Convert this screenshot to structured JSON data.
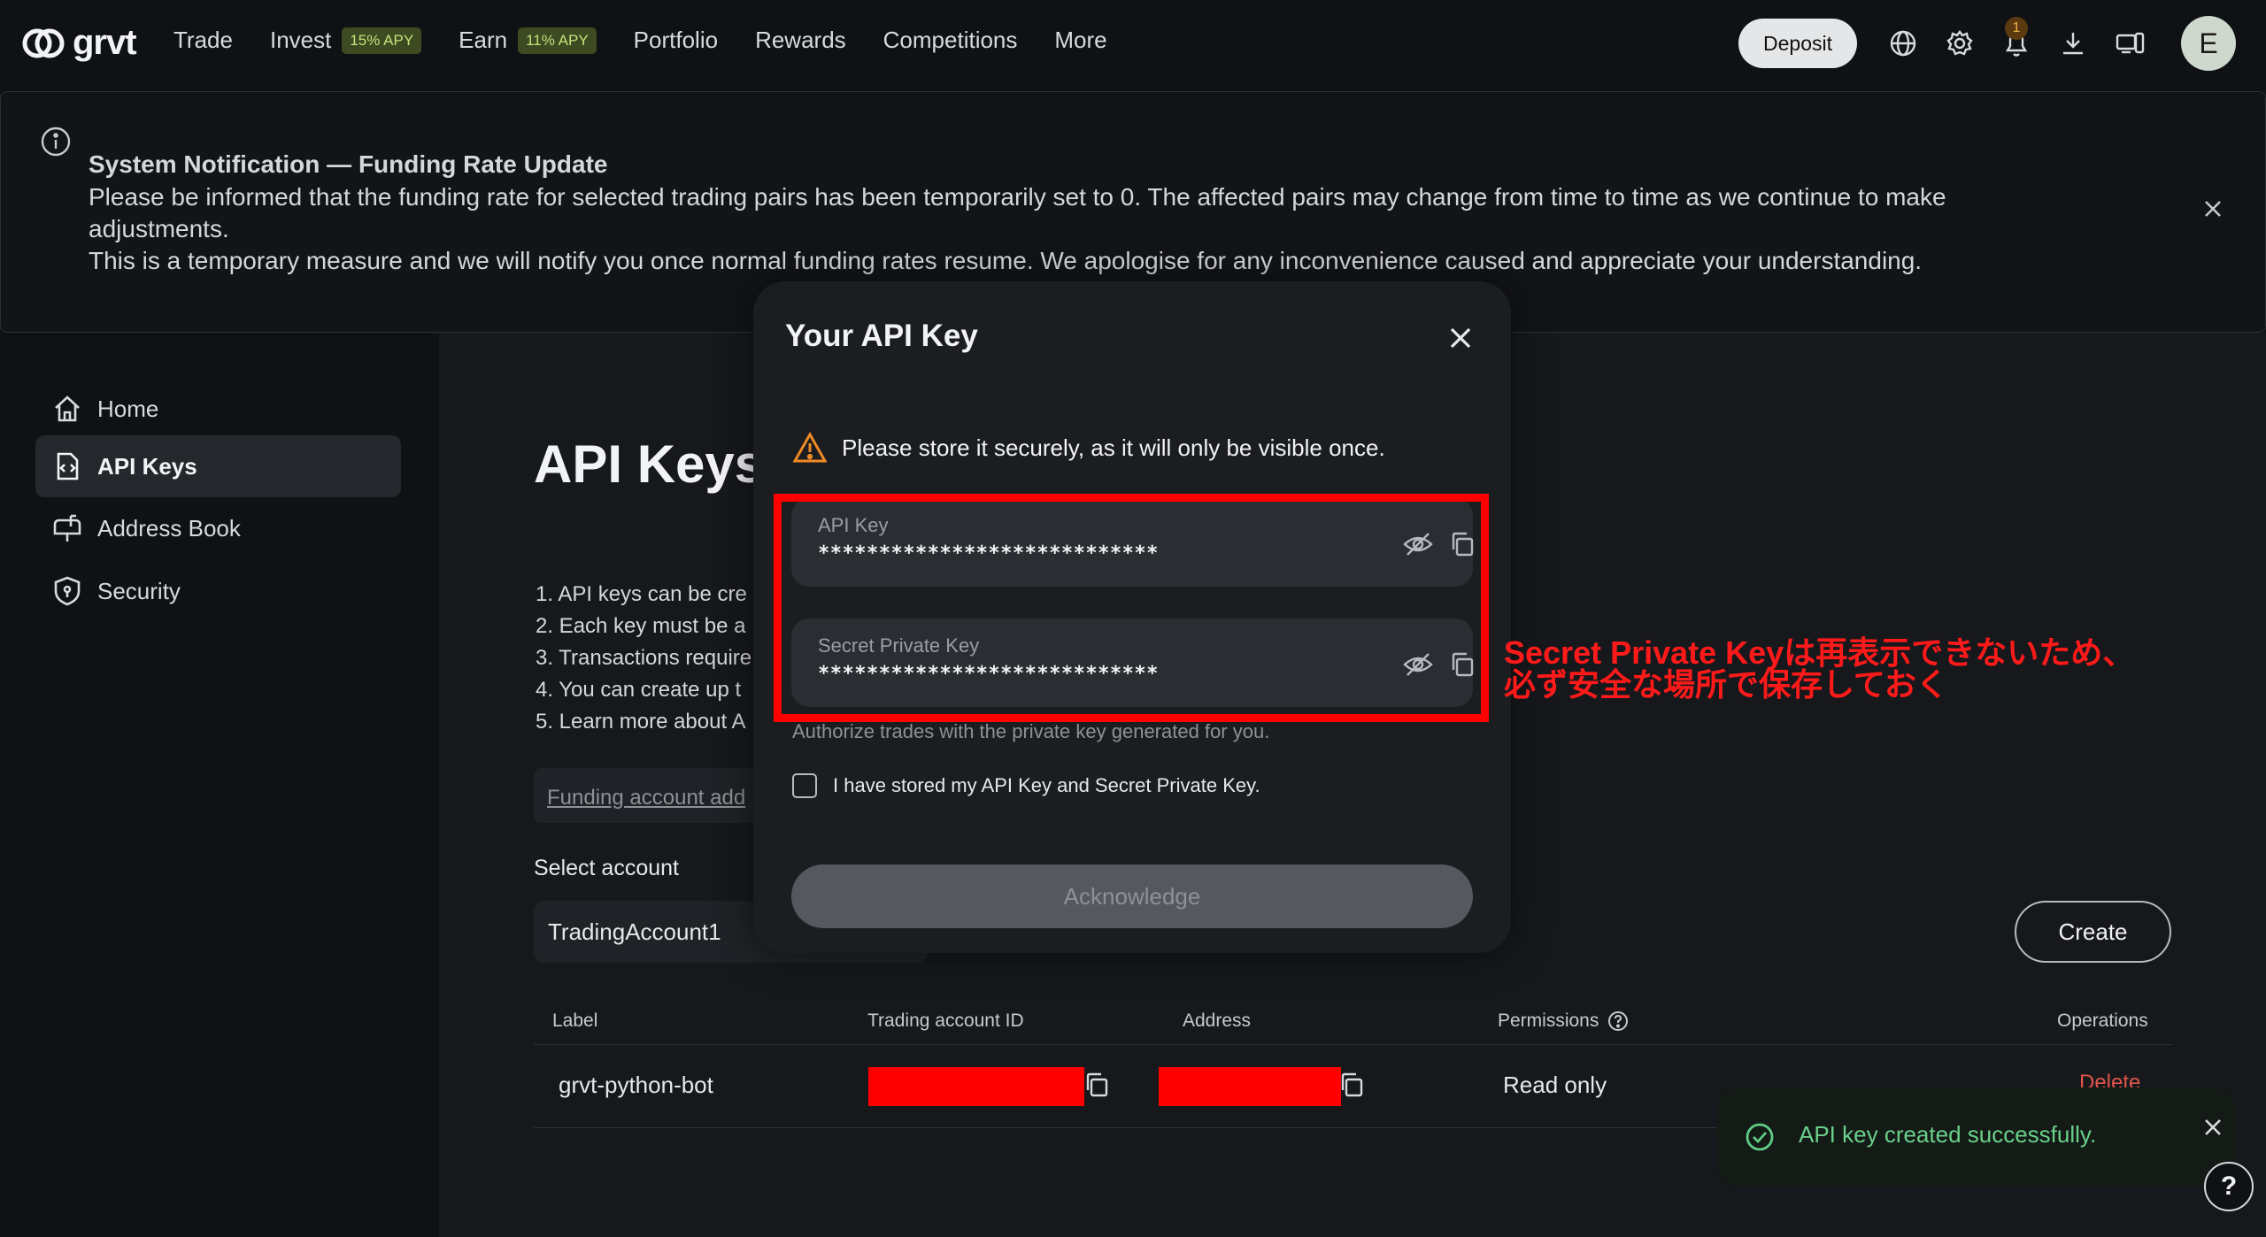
{
  "brand": {
    "logo_text": "grvt"
  },
  "nav": {
    "items": [
      {
        "label": "Trade"
      },
      {
        "label": "Invest",
        "badge": "15% APY"
      },
      {
        "label": "Earn",
        "badge": "11% APY"
      },
      {
        "label": "Portfolio"
      },
      {
        "label": "Rewards"
      },
      {
        "label": "Competitions"
      },
      {
        "label": "More"
      }
    ],
    "deposit_label": "Deposit",
    "notification_count": "1",
    "avatar_initial": "E"
  },
  "banner": {
    "title": "System Notification — Funding Rate Update",
    "line1": "Please be informed that the funding rate for selected trading pairs has been temporarily set to 0. The affected pairs may change from time to time as we continue to make adjustments.",
    "line2": "This is a temporary measure and we will notify you once normal funding rates resume. We apologise for any inconvenience caused and appreciate your understanding."
  },
  "sidebar": {
    "items": [
      {
        "label": "Home"
      },
      {
        "label": "API Keys",
        "active": true
      },
      {
        "label": "Address Book"
      },
      {
        "label": "Security"
      }
    ]
  },
  "main": {
    "title": "API Keys",
    "rules": [
      "1. API keys can be cre",
      "2. Each key must be a",
      "3. Transactions require",
      "4. You can create up t",
      "5. Learn more about A"
    ],
    "funding_text": "Funding account add",
    "select_label": "Select account",
    "selected_account": "TradingAccount1",
    "create_label": "Create",
    "table": {
      "headers": [
        "Label",
        "Trading account ID",
        "Address",
        "Permissions",
        "Operations"
      ],
      "rows": [
        {
          "label": "grvt-python-bot",
          "permissions": "Read only",
          "operation": "Delete"
        }
      ]
    }
  },
  "modal": {
    "title": "Your API Key",
    "warning": "Please store it securely, as it will only be visible once.",
    "api_key_label": "API Key",
    "api_key_value": "****************************",
    "secret_label": "Secret Private Key",
    "secret_value": "****************************",
    "hint": "Authorize trades with the private key generated for you.",
    "checkbox_label": "I have stored my API Key and Secret Private Key.",
    "ack_label": "Acknowledge"
  },
  "annotation": {
    "line1": "Secret Private Keyは再表示できないため、",
    "line2": "必ず安全な場所で保存しておく",
    "color": "#ff0000"
  },
  "toast": {
    "message": "API key created successfully."
  },
  "help_label": "?"
}
